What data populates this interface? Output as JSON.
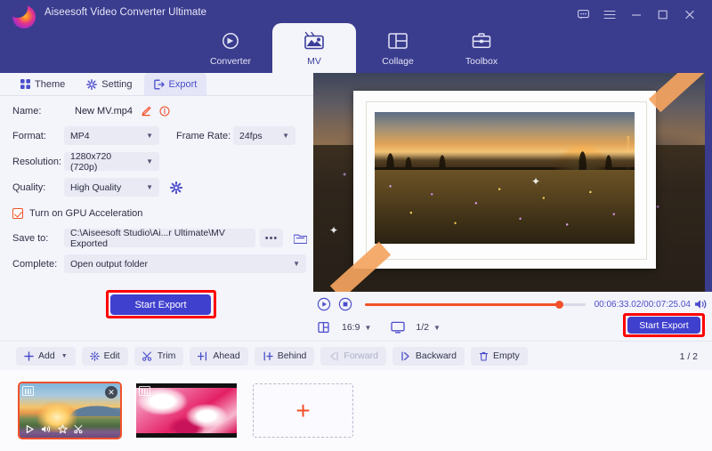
{
  "window": {
    "app_title": "Aiseesoft Video Converter Ultimate",
    "controls": [
      {
        "name": "feedback-icon",
        "glyph": "chat"
      },
      {
        "name": "menu-icon",
        "glyph": "hamburger"
      },
      {
        "name": "minimize-icon",
        "glyph": "minimize"
      },
      {
        "name": "maximize-icon",
        "glyph": "maximize"
      },
      {
        "name": "close-icon",
        "glyph": "close"
      }
    ],
    "accent_color": "#3a3c8e",
    "button_color": "#4040cf",
    "annotation_color": "#ff0000",
    "highlight_color": "#f2512a"
  },
  "main_tabs": [
    {
      "label": "Converter",
      "active": false
    },
    {
      "label": "MV",
      "active": true
    },
    {
      "label": "Collage",
      "active": false
    },
    {
      "label": "Toolbox",
      "active": false
    }
  ],
  "sub_tabs": [
    {
      "label": "Theme",
      "active": false
    },
    {
      "label": "Setting",
      "active": false
    },
    {
      "label": "Export",
      "active": true
    }
  ],
  "export_form": {
    "name_label": "Name:",
    "name_value": "New MV.mp4",
    "format_label": "Format:",
    "format_value": "MP4",
    "frame_rate_label": "Frame Rate:",
    "frame_rate_value": "24fps",
    "resolution_label": "Resolution:",
    "resolution_value": "1280x720 (720p)",
    "quality_label": "Quality:",
    "quality_value": "High Quality",
    "gpu_label": "Turn on GPU Acceleration",
    "gpu_checked": true,
    "save_to_label": "Save to:",
    "save_to_value": "C:\\Aiseesoft Studio\\Ai...r Ultimate\\MV Exported",
    "browse_label": "•••",
    "complete_label": "Complete:",
    "complete_value": "Open output folder",
    "start_export_label": "Start Export"
  },
  "player": {
    "timecode": "00:06:33.02/00:07:25.04",
    "progress_percent": 88,
    "aspect_ratio": "16:9",
    "zoom_level": "1/2",
    "start_export_label": "Start Export"
  },
  "toolbar": {
    "buttons": [
      {
        "label": "Add",
        "icon": "plus-icon",
        "dropdown": true,
        "disabled": false
      },
      {
        "label": "Edit",
        "icon": "wand-icon",
        "dropdown": false,
        "disabled": false
      },
      {
        "label": "Trim",
        "icon": "scissors-icon",
        "dropdown": false,
        "disabled": false
      },
      {
        "label": "Ahead",
        "icon": "insert-ahead-icon",
        "dropdown": false,
        "disabled": false
      },
      {
        "label": "Behind",
        "icon": "insert-behind-icon",
        "dropdown": false,
        "disabled": false
      },
      {
        "label": "Forward",
        "icon": "move-forward-icon",
        "dropdown": false,
        "disabled": true
      },
      {
        "label": "Backward",
        "icon": "move-backward-icon",
        "dropdown": false,
        "disabled": false
      },
      {
        "label": "Empty",
        "icon": "trash-icon",
        "dropdown": false,
        "disabled": false
      }
    ],
    "page_indicator": "1 / 2"
  },
  "thumbnails": [
    {
      "name": "clip-sunset-meadow",
      "selected": true,
      "close_label": "✕",
      "tools": [
        "play-icon",
        "volume-icon",
        "effects-icon",
        "trim-icon"
      ]
    },
    {
      "name": "clip-pink-texture",
      "selected": false
    }
  ],
  "add_slot": {
    "label": "+"
  }
}
